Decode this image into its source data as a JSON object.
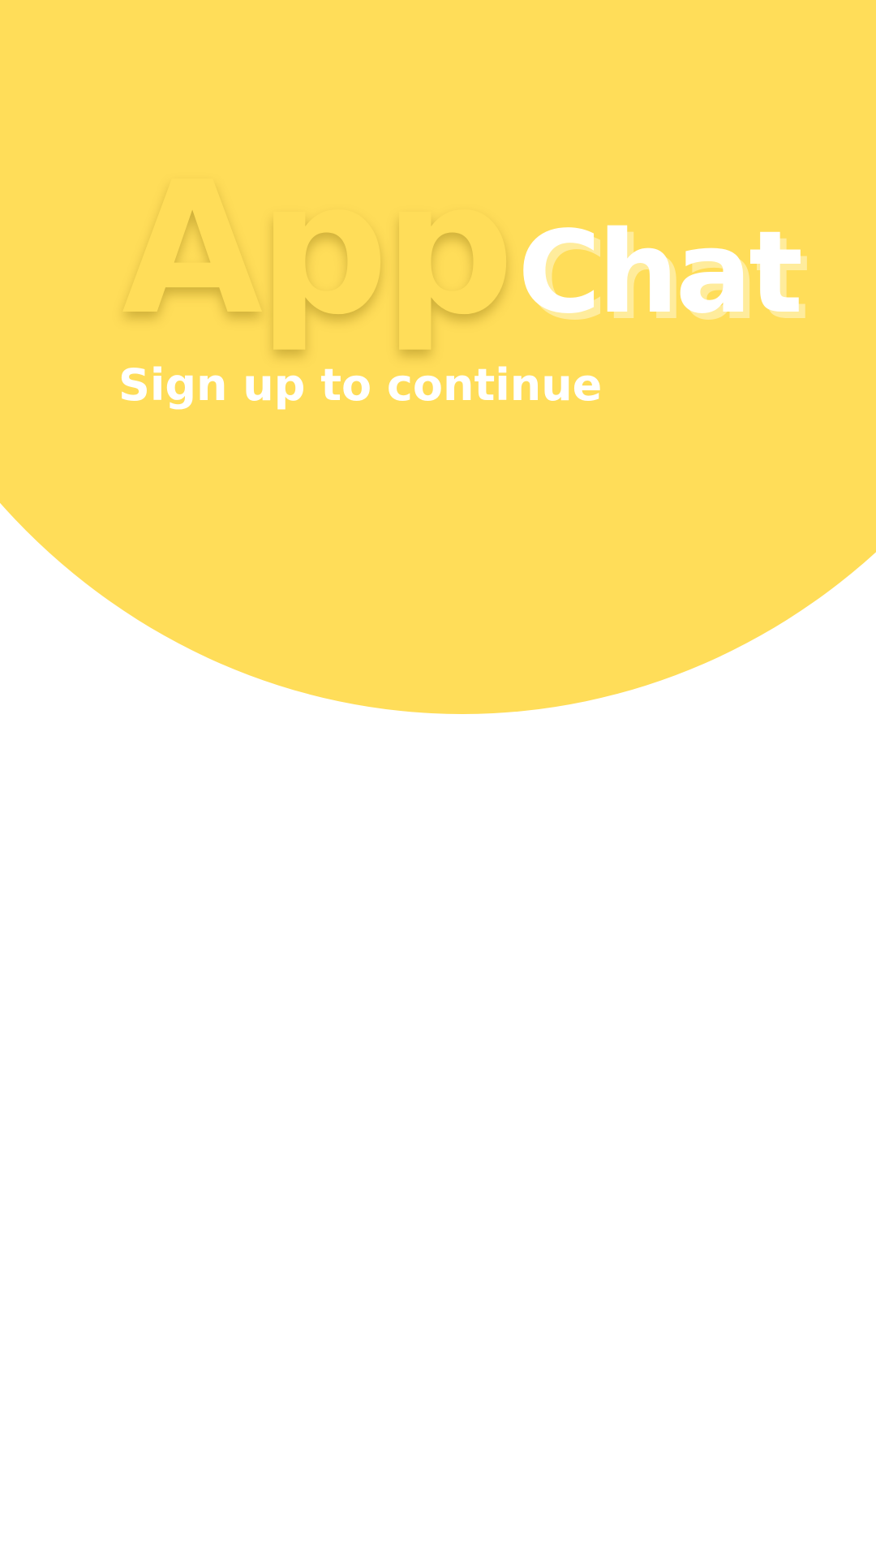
{
  "theme": {
    "accent": "#FFDD59",
    "background": "#FFFFFF",
    "text_on_accent": "#FFFFFF"
  },
  "brand": {
    "part1": "App",
    "part2": "Chat"
  },
  "header": {
    "subtitle": "Sign up to continue"
  }
}
